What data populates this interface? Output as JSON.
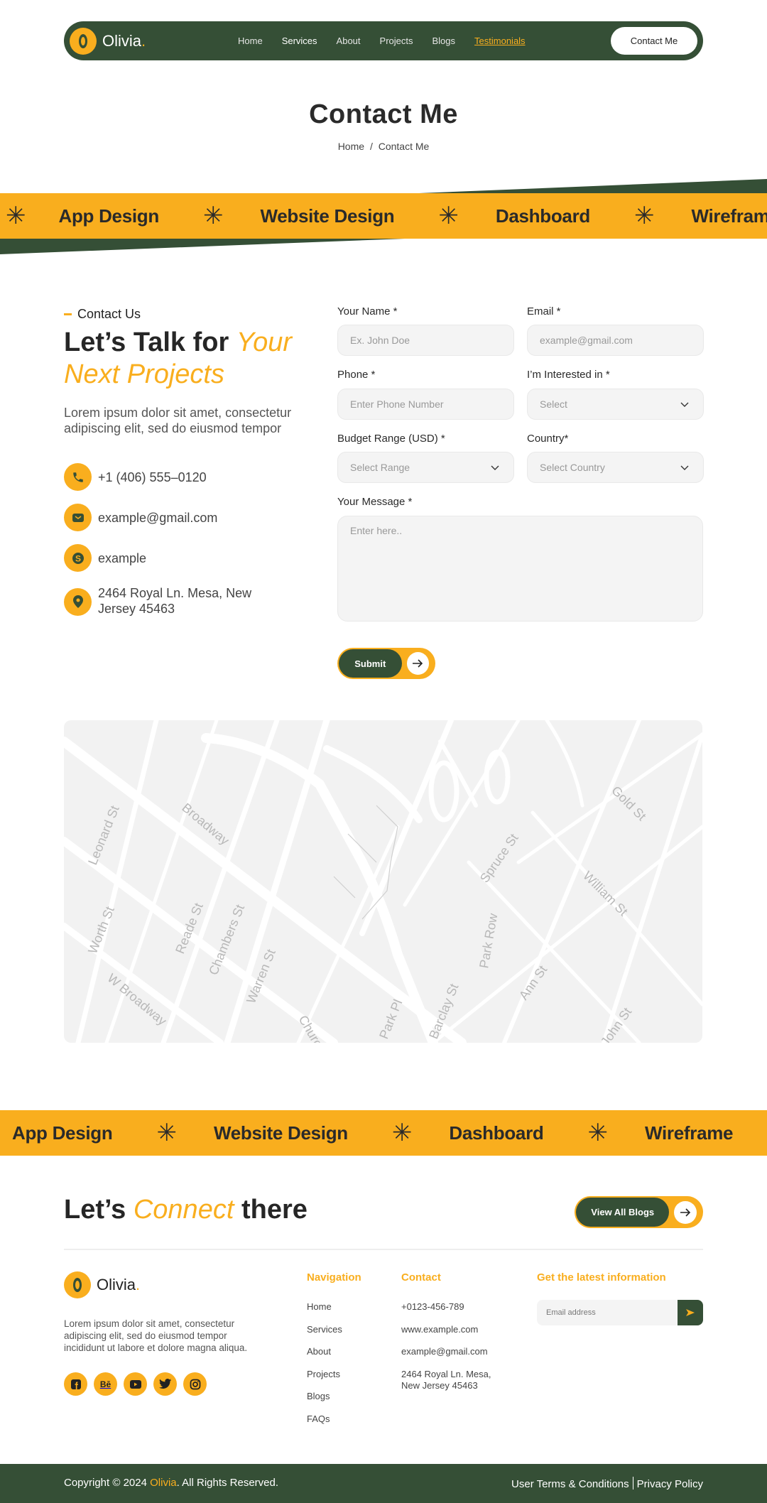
{
  "brand": {
    "name": "Olivia",
    "dot": ".",
    "initial": "O"
  },
  "nav": {
    "items": [
      {
        "label": "Home"
      },
      {
        "label": "Services"
      },
      {
        "label": "About"
      },
      {
        "label": "Projects"
      },
      {
        "label": "Blogs"
      },
      {
        "label": "Testimonials"
      }
    ],
    "cta": "Contact Me"
  },
  "hero": {
    "title": "Contact Me",
    "breadcrumb": [
      "Home",
      "/",
      "Contact Me"
    ]
  },
  "ticker": {
    "items": [
      "App Design",
      "Website Design",
      "Dashboard",
      "Wireframe"
    ],
    "separator": "✳"
  },
  "contact": {
    "eyebrow": "Contact Us",
    "heading_plain": "Let’s Talk for ",
    "heading_accent": "Your Next Projects",
    "lead": "Lorem ipsum dolor sit amet, consectetur adipiscing elit, sed do eiusmod tempor",
    "info": [
      {
        "icon": "phone-icon",
        "text": "+1 (406) 555–0120"
      },
      {
        "icon": "mail-icon",
        "text": "example@gmail.com"
      },
      {
        "icon": "skype-icon",
        "text": "example"
      },
      {
        "icon": "location-pin-icon",
        "text": "2464 Royal Ln. Mesa, New Jersey 45463"
      }
    ]
  },
  "form": {
    "name": {
      "label": "Your Name *",
      "placeholder": "Ex. John Doe"
    },
    "email": {
      "label": "Email *",
      "placeholder": "example@gmail.com"
    },
    "phone": {
      "label": "Phone *",
      "placeholder": "Enter Phone Number"
    },
    "interest": {
      "label": "I’m Interested in *",
      "selected": "Select"
    },
    "budget": {
      "label": "Budget Range (USD) *",
      "selected": "Select Range"
    },
    "country": {
      "label": "Country*",
      "selected": "Select Country"
    },
    "message": {
      "label": "Your Message *",
      "placeholder": "Enter here.."
    },
    "submit": "Submit"
  },
  "map": {
    "streets": [
      "Leonard St",
      "Broadway",
      "Worth St",
      "Reade St",
      "Chambers St",
      "Warren St",
      "W Broadway",
      "Church St",
      "Park Pl",
      "Barclay St",
      "Park Row",
      "Spruce St",
      "Gold St",
      "William St",
      "Ann St",
      "John St"
    ]
  },
  "connect": {
    "plain1": "Let’s ",
    "accent": "Connect",
    "plain2": " there",
    "button": "View All Blogs"
  },
  "footer": {
    "description": "Lorem ipsum dolor sit amet, consectetur adipiscing elit, sed do eiusmod tempor incididunt ut labore et dolore magna aliqua.",
    "socials": [
      "facebook-icon",
      "behance-icon",
      "youtube-icon",
      "twitter-icon",
      "instagram-icon"
    ],
    "navigation": {
      "title": "Navigation",
      "items": [
        "Home",
        "Services",
        "About",
        "Projects",
        "Blogs",
        "FAQs"
      ]
    },
    "contact": {
      "title": "Contact",
      "items": [
        "+0123-456-789",
        "www.example.com",
        "example@gmail.com",
        "2464 Royal Ln. Mesa, New Jersey 45463"
      ]
    },
    "newsletter": {
      "title": "Get the latest information",
      "placeholder": "Email address"
    }
  },
  "bottom": {
    "copyright_pre": "Copyright © 2024 ",
    "copyright_brand": "Olivia",
    "copyright_post": ". All Rights Reserved.",
    "terms": "User Terms & Conditions",
    "privacy": "Privacy Policy"
  },
  "colors": {
    "green": "#354f36",
    "yellow": "#f9ae1e",
    "field": "#f4f4f4"
  }
}
